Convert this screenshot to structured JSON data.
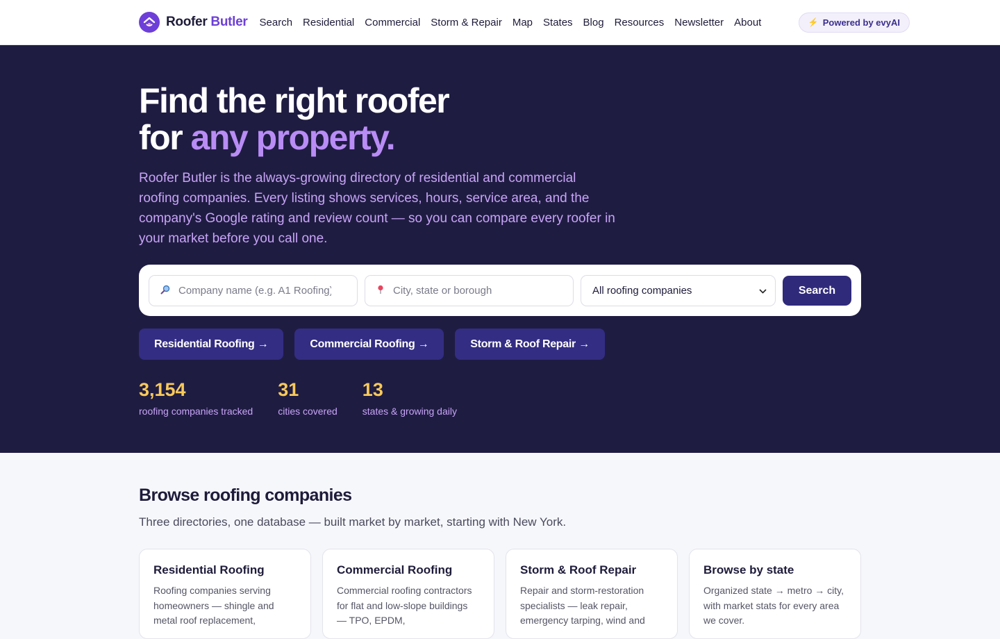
{
  "header": {
    "logo_icon": "house-logo-icon",
    "brand_first": "Roofer",
    "brand_second": "Butler",
    "nav": [
      "Search",
      "Residential",
      "Commercial",
      "Storm & Repair",
      "Map",
      "States",
      "Blog",
      "Resources",
      "Newsletter",
      "About"
    ],
    "powered_icon": "lightning-bolt-icon",
    "powered_label": "Powered by evyAI"
  },
  "hero": {
    "title_line1": "Find the right roofer",
    "title_line2_plain": "for ",
    "title_line2_accent": "any property.",
    "lead": "Roofer Butler is the always-growing directory of residential and commercial roofing companies. Every listing shows services, hours, service area, and the company's Google rating and review count — so you can compare every roofer in your market before you call one.",
    "search": {
      "company_placeholder": "Company name (e.g. A1 Roofing)",
      "company_icon": "magnifier-icon",
      "city_placeholder": "City, state or borough",
      "city_icon": "map-pin-icon",
      "type_selected": "All roofing companies",
      "button_label": "Search"
    },
    "category_buttons": [
      "Residential Roofing →",
      "Commercial Roofing →",
      "Storm & Roof Repair →"
    ],
    "stats": [
      {
        "value": "3,154",
        "label": "roofing companies tracked"
      },
      {
        "value": "31",
        "label": "cities covered"
      },
      {
        "value": "13",
        "label": "states & growing daily"
      }
    ]
  },
  "browse": {
    "title": "Browse roofing companies",
    "subtitle": "Three directories, one database — built market by market, starting with New York.",
    "cards": [
      {
        "title": "Residential Roofing",
        "text": "Roofing companies serving homeowners — shingle and metal roof replacement,"
      },
      {
        "title": "Commercial Roofing",
        "text": "Commercial roofing contractors for flat and low-slope buildings — TPO, EPDM,"
      },
      {
        "title": "Storm & Roof Repair",
        "text": "Repair and storm-restoration specialists — leak repair, emergency tarping, wind and"
      },
      {
        "title": "Browse by state",
        "text": "Organized state → metro → city, with market stats for every area we cover."
      }
    ]
  },
  "colors": {
    "brand_purple": "#6d3fd8",
    "hero_bg": "#1f1c42",
    "accent_lilac": "#b98cf5",
    "stat_yellow": "#f7c95c",
    "button_navy": "#332d83"
  }
}
